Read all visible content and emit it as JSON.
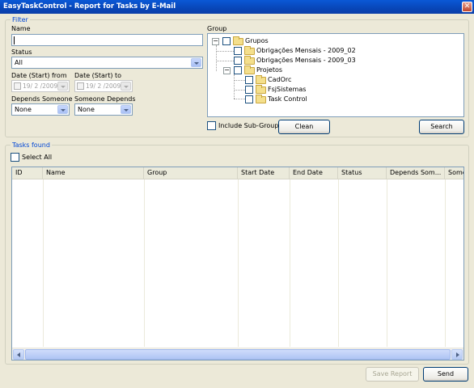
{
  "window": {
    "title": "EasyTaskControl - Report for Tasks by E-Mail"
  },
  "filter": {
    "legend": "Filter",
    "name_label": "Name",
    "name_value": "",
    "status_label": "Status",
    "status_value": "All",
    "date_from_label": "Date (Start) from",
    "date_from_value": "19/ 2 /2009",
    "date_to_label": "Date (Start) to",
    "date_to_value": "19/ 2 /2009",
    "depends_someone_label": "Depends Someone",
    "depends_someone_value": "None",
    "someone_depends_label": "Someone Depends",
    "someone_depends_value": "None",
    "group_label": "Group",
    "tree": [
      {
        "label": "Grupos"
      },
      {
        "label": "Obrigações Mensais - 2009_02"
      },
      {
        "label": "Obrigações Mensais - 2009_03"
      },
      {
        "label": "Projetos"
      },
      {
        "label": "CadOrc"
      },
      {
        "label": "FsjSistemas"
      },
      {
        "label": "Task Control"
      }
    ],
    "include_subgroups_label": "Include Sub-Groups",
    "clean_label": "Clean",
    "search_label": "Search"
  },
  "tasks": {
    "legend": "Tasks found",
    "select_all_label": "Select All",
    "columns": [
      "ID",
      "Name",
      "Group",
      "Start Date",
      "End Date",
      "Status",
      "Depends Som...",
      "Some"
    ]
  },
  "footer": {
    "save_report_label": "Save Report",
    "send_label": "Send"
  }
}
